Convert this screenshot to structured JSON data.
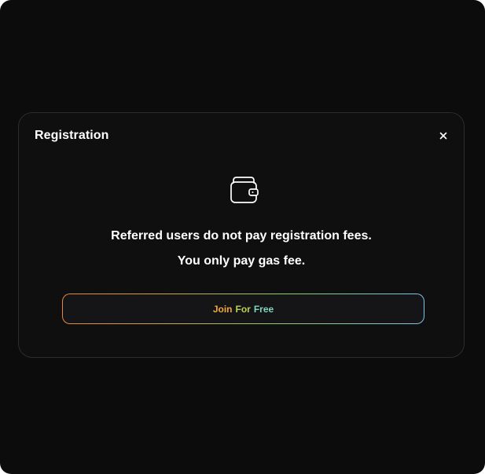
{
  "modal": {
    "title": "Registration",
    "close_icon": "close-icon",
    "wallet_icon": "wallet-icon",
    "message_line_1": "Referred users do not pay registration fees.",
    "message_line_2": "You only pay gas fee.",
    "join_button": {
      "word_1": "Join",
      "word_2": "For",
      "word_3": "Free"
    }
  },
  "colors": {
    "background": "#0c0c0d",
    "modal_background": "#0f0f10",
    "modal_border": "#2c2c2e",
    "text": "#ffffff",
    "gradient_start": "#e8873c",
    "gradient_mid": "#8fcf6e",
    "gradient_end": "#7cc4e8"
  }
}
